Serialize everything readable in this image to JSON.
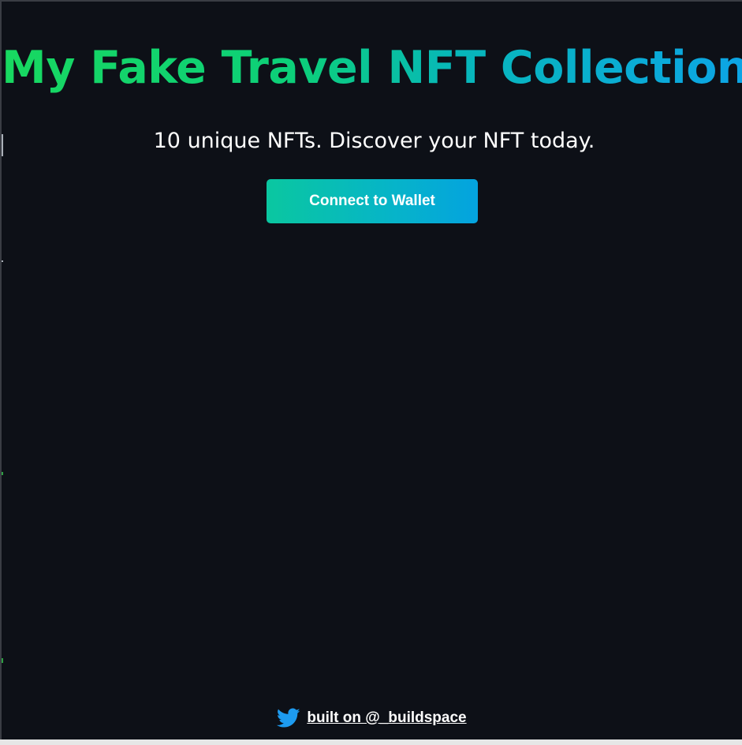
{
  "header": {
    "title": "My Fake Travel NFT Collection",
    "subtitle": "10 unique NFTs. Discover your NFT today."
  },
  "actions": {
    "connect_label": "Connect to Wallet"
  },
  "footer": {
    "icon": "twitter-icon",
    "link_text": "built on @_buildspace"
  },
  "colors": {
    "background": "#0d1017",
    "title_gradient_start": "#18d860",
    "title_gradient_end": "#0ca4e6",
    "button_gradient_start": "#0ac7a0",
    "button_gradient_end": "#04a3df",
    "twitter_blue": "#1d9bf0"
  }
}
